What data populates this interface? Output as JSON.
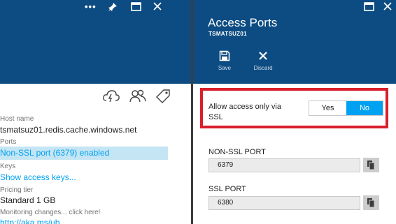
{
  "left_blade": {
    "controls": [
      "more-icon",
      "pin-icon",
      "maximize-icon",
      "close-icon"
    ],
    "toolbar_icons": [
      "cloud-refresh-icon",
      "users-icon",
      "tag-icon"
    ],
    "properties": [
      {
        "label": "Host name",
        "value": "tsmatsuz01.redis.cache.windows.net"
      },
      {
        "label": "Ports",
        "value": "Non-SSL port (6379) enabled"
      },
      {
        "label": "Keys",
        "value": "Show access keys..."
      },
      {
        "label": "Pricing tier",
        "value": "Standard 1 GB"
      },
      {
        "label": "Monitoring changes... click here!",
        "value": "http://aka.ms/ub"
      }
    ]
  },
  "right_blade": {
    "title": "Access Ports",
    "subtitle": "TSMATSUZ01",
    "controls": [
      "maximize-icon",
      "close-icon"
    ],
    "commands": [
      {
        "label": "Save",
        "icon": "save-icon"
      },
      {
        "label": "Discard",
        "icon": "discard-icon"
      }
    ],
    "ssl_setting": {
      "label": "Allow access only via SSL",
      "options": [
        "Yes",
        "No"
      ],
      "selected": "No"
    },
    "non_ssl_port": {
      "label": "NON-SSL PORT",
      "value": "6379"
    },
    "ssl_port": {
      "label": "SSL PORT",
      "value": "6380"
    }
  },
  "colors": {
    "header_bg": "#0d4c82",
    "accent": "#00a1f1",
    "highlight": "#c4e5f3",
    "callout": "#d9202b"
  }
}
